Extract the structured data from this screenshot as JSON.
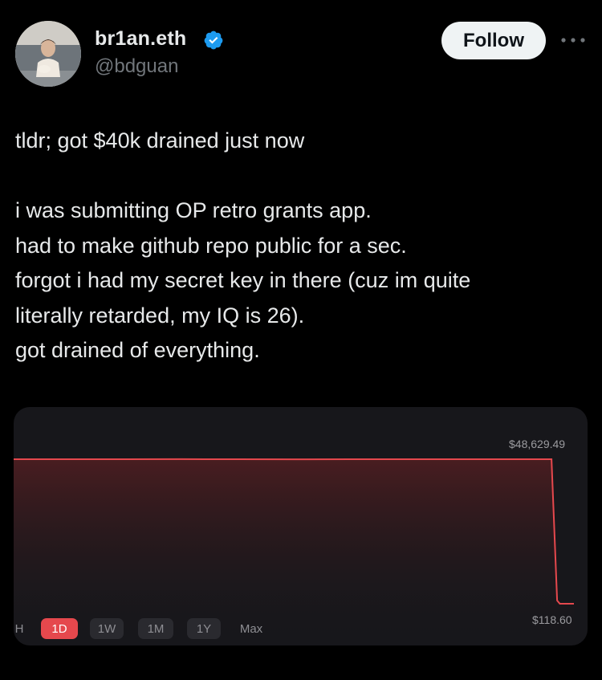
{
  "author": {
    "display_name": "br1an.eth",
    "handle": "@bdguan",
    "verified_color": "#1d9bf0",
    "avatar_icon": "avatar-photo"
  },
  "actions": {
    "follow_label": "Follow",
    "more_icon": "more-horizontal-icon"
  },
  "tweet": {
    "lines": [
      "tldr; got $40k drained just now",
      "",
      "i was submitting OP retro grants app.",
      "had to make github repo public for a sec.",
      "forgot i had my secret key in there (cuz im quite",
      "literally retarded, my IQ is 26).",
      "got drained of everything."
    ]
  },
  "chart": {
    "high_label": "$48,629.49",
    "low_label": "$118.60",
    "ranges": [
      "H",
      "1D",
      "1W",
      "1M",
      "1Y",
      "Max"
    ],
    "active_range": "1D",
    "accent_color": "#e5484d"
  },
  "chart_data": {
    "type": "line",
    "title": "",
    "xlabel": "",
    "ylabel": "",
    "x": [
      0,
      0.05,
      0.1,
      0.2,
      0.3,
      0.4,
      0.5,
      0.6,
      0.7,
      0.8,
      0.9,
      0.96,
      0.97,
      0.975,
      1.0
    ],
    "values": [
      48629.49,
      48629.49,
      48640,
      48620,
      48650,
      48629.49,
      48610,
      48629.49,
      48640,
      48629.49,
      48620,
      48629.49,
      1200,
      118.6,
      118.6
    ],
    "ylim": [
      118.6,
      48629.49
    ],
    "annotations": [
      "$48,629.49",
      "$118.60"
    ],
    "grid": false
  }
}
